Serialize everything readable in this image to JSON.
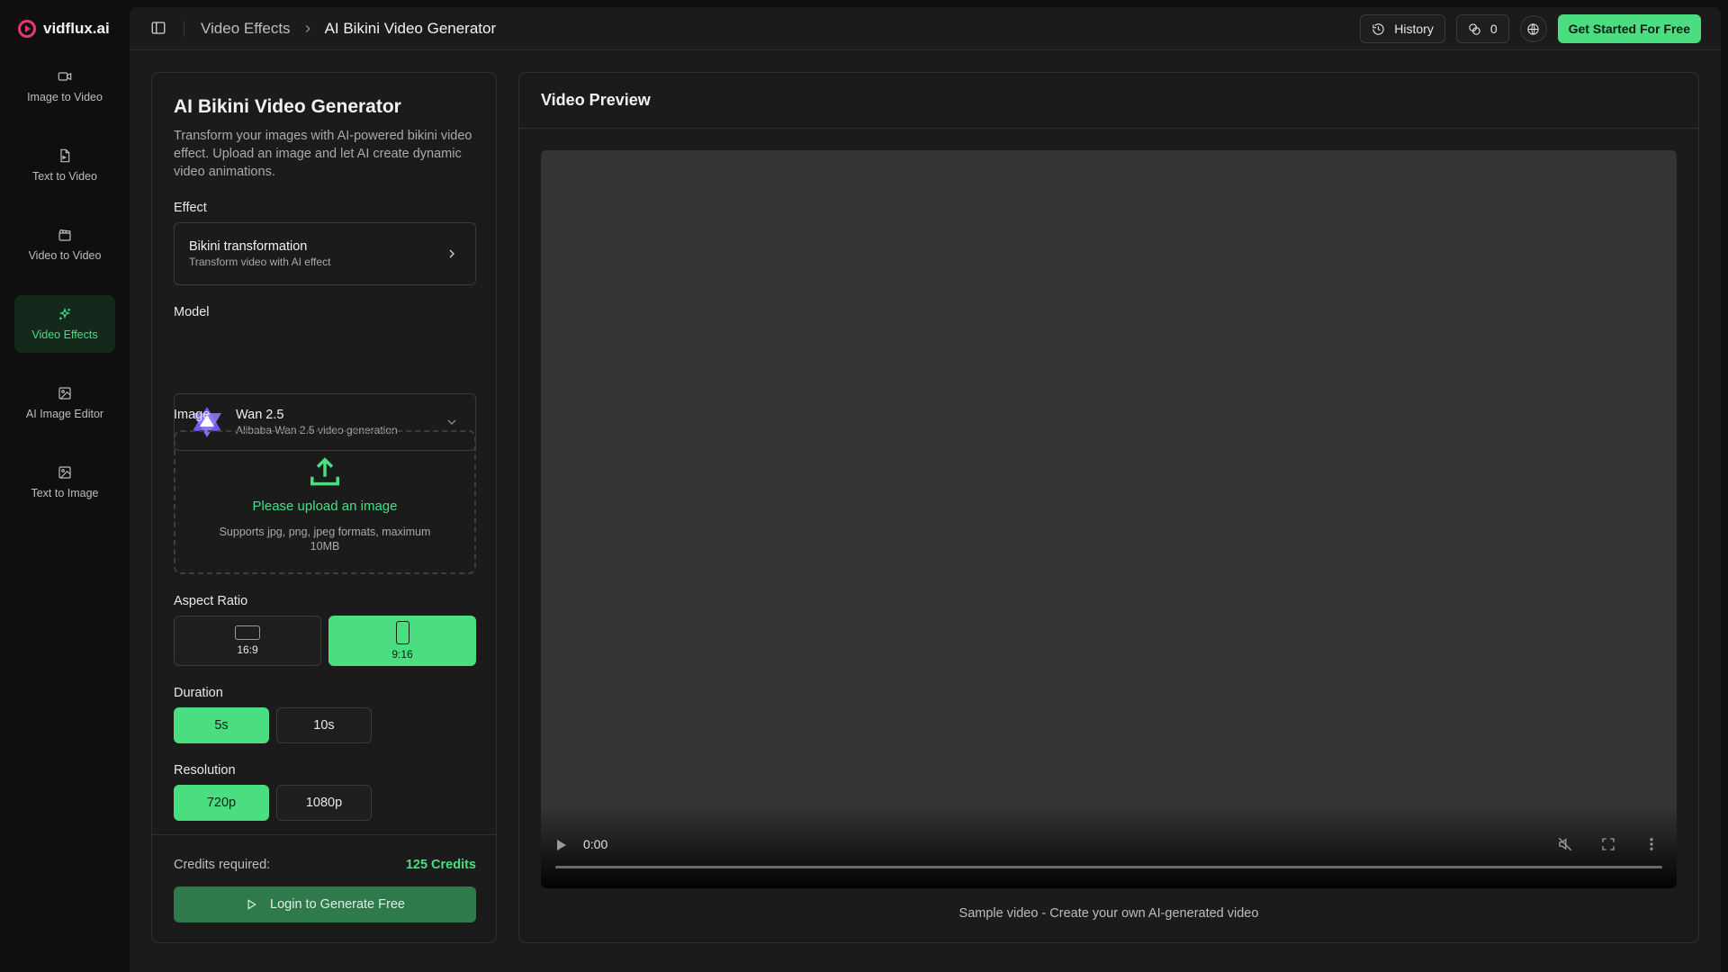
{
  "app": {
    "logo_text": "vidflux.ai"
  },
  "sidebar": {
    "items": [
      {
        "label": "Image to Video",
        "icon": "video-camera-icon"
      },
      {
        "label": "Text to Video",
        "icon": "document-icon"
      },
      {
        "label": "Video to Video",
        "icon": "clapperboard-icon"
      },
      {
        "label": "Video Effects",
        "icon": "sparkles-icon",
        "active": true
      },
      {
        "label": "AI Image Editor",
        "icon": "image-edit-icon"
      },
      {
        "label": "Text to Image",
        "icon": "image-icon"
      }
    ]
  },
  "header": {
    "breadcrumb": {
      "parent": "Video Effects",
      "current": "AI Bikini Video Generator"
    },
    "history_label": "History",
    "credits_count": "0",
    "cta_label": "Get Started For Free"
  },
  "form": {
    "title": "AI Bikini Video Generator",
    "description": "Transform your images with AI-powered bikini video effect. Upload an image and let AI create dynamic video animations.",
    "effect": {
      "label": "Effect",
      "title": "Bikini transformation",
      "subtitle": "Transform video with AI effect"
    },
    "model": {
      "label": "Model",
      "title": "Wan 2.5",
      "subtitle": "Alibaba Wan 2.5 video generation"
    },
    "image": {
      "label": "Image",
      "upload_title": "Please upload an image",
      "upload_hint": "Supports jpg, png, jpeg formats, maximum 10MB"
    },
    "aspect_ratio": {
      "label": "Aspect Ratio",
      "options": [
        "16:9",
        "9:16"
      ],
      "selected": "9:16"
    },
    "duration": {
      "label": "Duration",
      "options": [
        "5s",
        "10s"
      ],
      "selected": "5s"
    },
    "resolution": {
      "label": "Resolution",
      "options": [
        "720p",
        "1080p"
      ],
      "selected": "720p"
    },
    "credits": {
      "label": "Credits required:",
      "value": "125 Credits"
    },
    "submit_label": "Login to Generate Free"
  },
  "preview": {
    "title": "Video Preview",
    "time": "0:00",
    "caption": "Sample video - Create your own AI-generated video"
  },
  "colors": {
    "accent": "#4ade80",
    "background": "#0f0f10",
    "panel": "#1b1b1c",
    "logo": "#e63a6e"
  }
}
